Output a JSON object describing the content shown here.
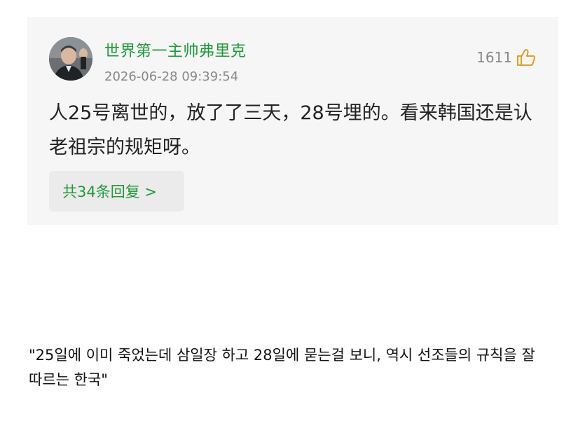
{
  "comment": {
    "username": "世界第一主帅弗里克",
    "timestamp": "2026-06-28 09:39:54",
    "like_count": "1611",
    "like_icon": "thumbs-up-icon",
    "body": "人25号离世的，放了了三天，28号埋的。看来韩国还是认老祖宗的规矩呀。",
    "replies_label": "共34条回复 >",
    "accent_color": "#1e9a3a"
  },
  "translation": {
    "text": "\"25일에 이미 죽었는데 삼일장 하고 28일에 묻는걸 보니, 역시 선조들의 규칙을 잘 따르는 한국\""
  }
}
